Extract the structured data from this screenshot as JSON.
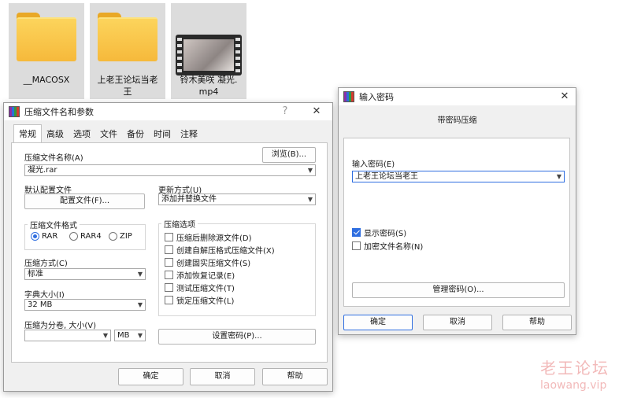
{
  "desktop": {
    "files": [
      {
        "name": "__MACOSX",
        "type": "folder"
      },
      {
        "name": "上老王论坛当老\n王",
        "type": "folder"
      },
      {
        "name": "铃木美咲 凝光.\nmp4",
        "type": "video"
      }
    ]
  },
  "archive_dialog": {
    "title": "压缩文件名和参数",
    "help_icon": "?",
    "tabs": [
      "常规",
      "高级",
      "选项",
      "文件",
      "备份",
      "时间",
      "注释"
    ],
    "archive_name_label": "压缩文件名称(A)",
    "browse_button": "浏览(B)...",
    "archive_name_value": "凝光.rar",
    "profile_label": "默认配置文件",
    "profile_button": "配置文件(F)...",
    "update_label": "更新方式(U)",
    "update_value": "添加并替换文件",
    "format_group": "压缩文件格式",
    "formats": [
      "RAR",
      "RAR4",
      "ZIP"
    ],
    "format_selected": "RAR",
    "method_label": "压缩方式(C)",
    "method_value": "标准",
    "dict_label": "字典大小(I)",
    "dict_value": "32 MB",
    "split_label": "压缩为分卷, 大小(V)",
    "split_value": "",
    "split_unit": "MB",
    "options_group": "压缩选项",
    "options": [
      {
        "label": "压缩后删除源文件(D)",
        "checked": false
      },
      {
        "label": "创建自解压格式压缩文件(X)",
        "checked": false
      },
      {
        "label": "创建固实压缩文件(S)",
        "checked": false
      },
      {
        "label": "添加恢复记录(E)",
        "checked": false
      },
      {
        "label": "测试压缩文件(T)",
        "checked": false
      },
      {
        "label": "锁定压缩文件(L)",
        "checked": false
      }
    ],
    "set_password_button": "设置密码(P)...",
    "ok_button": "确定",
    "cancel_button": "取消",
    "help_button": "帮助"
  },
  "password_dialog": {
    "title": "输入密码",
    "heading": "带密码压缩",
    "password_label": "输入密码(E)",
    "password_value": "上老王论坛当老王",
    "show_password": {
      "label": "显示密码(S)",
      "checked": true
    },
    "encrypt_names": {
      "label": "加密文件名称(N)",
      "checked": false
    },
    "manage_button": "管理密码(O)...",
    "ok_button": "确定",
    "cancel_button": "取消",
    "help_button": "帮助"
  },
  "watermark": {
    "line1": "老王论坛",
    "line2": "laowang.vip"
  },
  "colors": {
    "accent": "#2f6ee0",
    "folder": "#f6b93b",
    "watermark": "#f2b9b9"
  }
}
